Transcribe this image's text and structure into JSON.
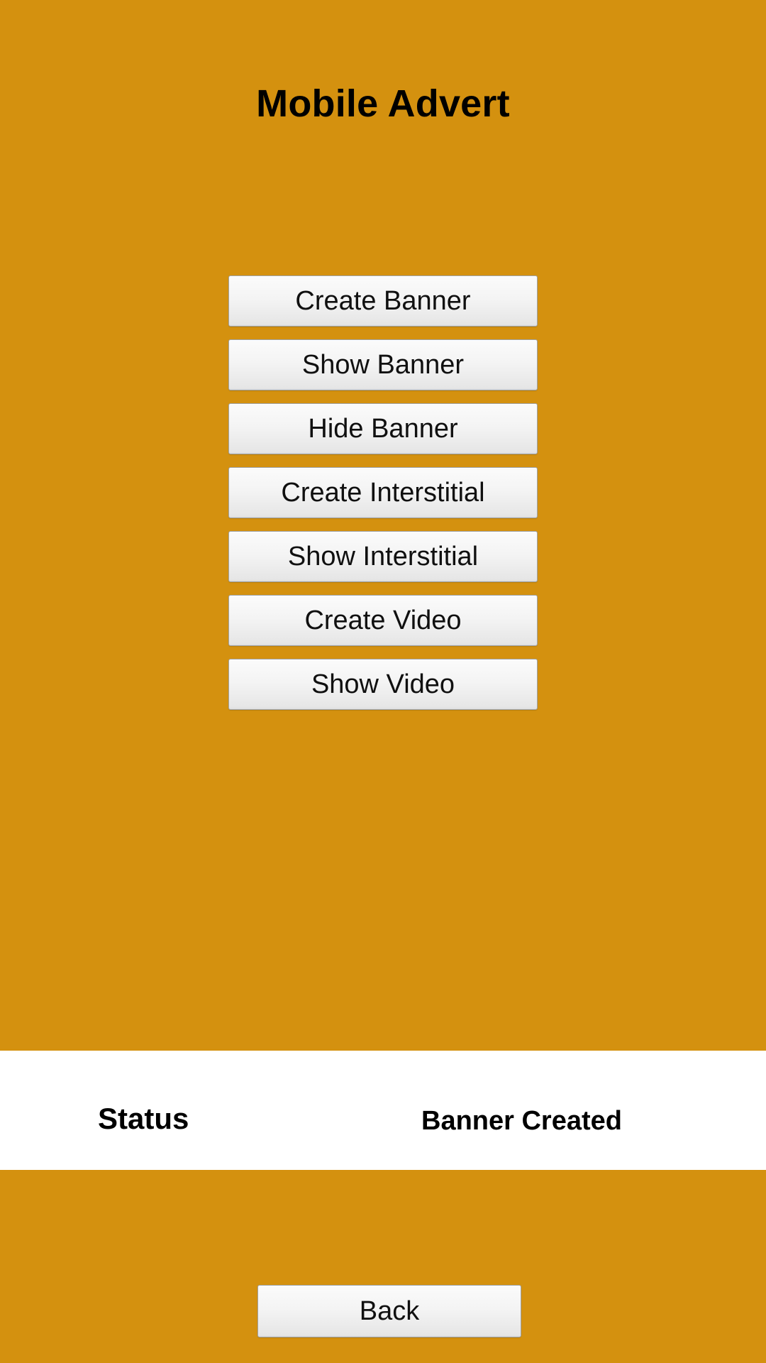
{
  "app": {
    "title": "Mobile Advert",
    "background_color": "#d4910f",
    "panel_color": "#ffffff",
    "text_color": "#000000"
  },
  "main": {
    "buttons": [
      {
        "label": "Create Banner",
        "name": "create-banner-button"
      },
      {
        "label": "Show Banner",
        "name": "show-banner-button"
      },
      {
        "label": "Hide Banner",
        "name": "hide-banner-button"
      },
      {
        "label": "Create Interstitial",
        "name": "create-interstitial-button"
      },
      {
        "label": "Show Interstitial",
        "name": "show-interstitial-button"
      },
      {
        "label": "Create Video",
        "name": "create-video-button"
      },
      {
        "label": "Show Video",
        "name": "show-video-button"
      }
    ]
  },
  "status": {
    "label": "Status",
    "value": "Banner Created"
  },
  "footer": {
    "back_label": "Back"
  }
}
